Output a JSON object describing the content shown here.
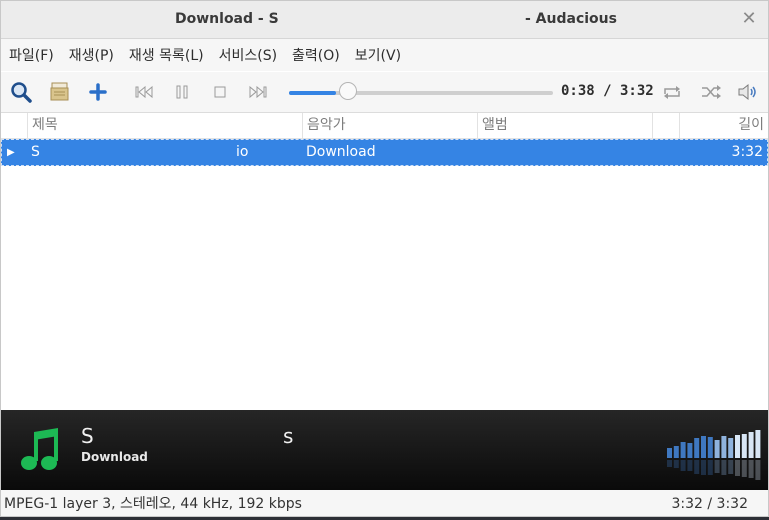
{
  "window": {
    "title_left": "Download - S",
    "title_right": "- Audacious"
  },
  "menu": [
    "파일(F)",
    "재생(P)",
    "재생 목록(L)",
    "서비스(S)",
    "출력(O)",
    "보기(V)"
  ],
  "toolbar": {
    "icons": [
      "search-icon",
      "open-folder-icon",
      "add-icon",
      "previous-icon",
      "pause-icon",
      "stop-icon",
      "next-icon",
      "repeat-icon",
      "shuffle-icon",
      "volume-icon"
    ],
    "time": "0:38 / 3:32",
    "progress": 0.179
  },
  "playlist": {
    "columns": [
      "제목",
      "음악가",
      "앨범",
      "",
      "길이"
    ],
    "rows": [
      {
        "title_a": "S",
        "title_b": "io",
        "artist": "Download",
        "album": "",
        "length": "3:32"
      }
    ]
  },
  "infobar": {
    "title_a": "S",
    "title_b": "s",
    "artist": "Download"
  },
  "status": {
    "format": "MPEG-1 layer 3, 스테레오, 44 kHz, 192 kbps",
    "time": "3:32 / 3:32"
  },
  "colors": {
    "accent": "#3584e4",
    "music_icon": "#1db954"
  }
}
